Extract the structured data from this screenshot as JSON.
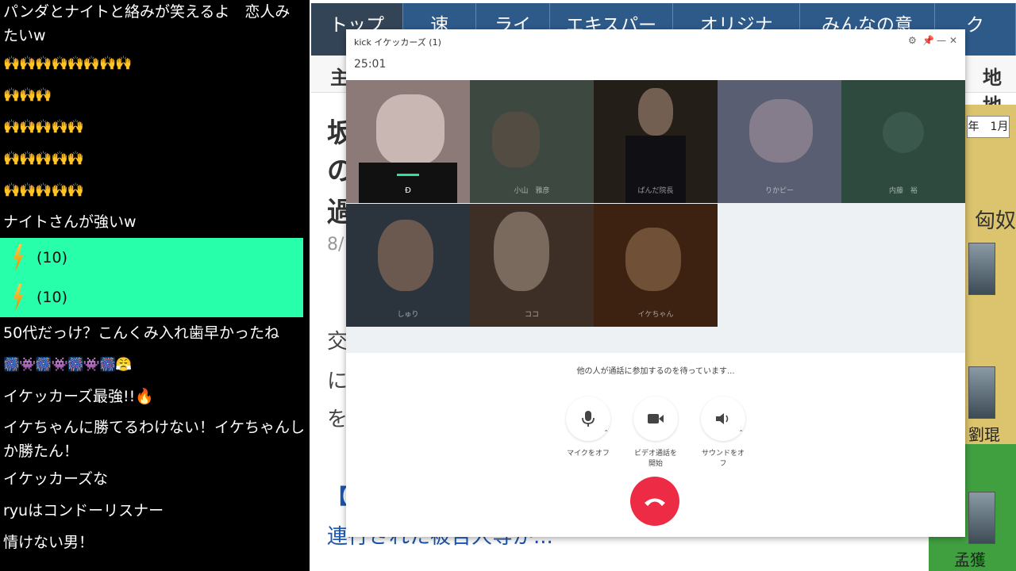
{
  "chat": {
    "messages": [
      {
        "type": "text",
        "text": "パンダとナイトと絡みが笑えるよ　恋人みたいw"
      },
      {
        "type": "emotes",
        "text": "🙌🙌🙌🙌🙌🙌🙌🙌"
      },
      {
        "type": "emotes",
        "text": "🙌🙌🙌"
      },
      {
        "type": "emotes",
        "text": "🙌🙌🙌🙌🙌"
      },
      {
        "type": "emotes",
        "text": "🙌🙌🙌🙌🙌"
      },
      {
        "type": "emotes",
        "text": "🙌🙌🙌🙌🙌"
      },
      {
        "type": "text",
        "text": "ナイトさんが強いw"
      },
      {
        "type": "tip",
        "text": "(10)"
      },
      {
        "type": "tip",
        "text": "(10)"
      },
      {
        "type": "text",
        "text": "50代だっけ？こんくみ入れ歯早かったね"
      },
      {
        "type": "emotes",
        "text": "🎆👾🎆👾🎆👾🎆😤"
      },
      {
        "type": "text",
        "text": "イケッカーズ最強!!🔥"
      },
      {
        "type": "text",
        "text": "イケちゃんに勝てるわけない！イケちゃんしか勝たん！"
      },
      {
        "type": "text",
        "text": "イケッカーズな"
      },
      {
        "type": "text",
        "text": "ryuはコンドーリスナー"
      },
      {
        "type": "text",
        "text": "情けない男！"
      }
    ]
  },
  "background_page": {
    "nav_tabs": [
      "トップ",
      "速",
      "ライ",
      "エキスパー",
      "オリジナ",
      "みんなの意",
      "ク"
    ],
    "sub_left": "主",
    "sub_right": "地地",
    "headline_lines": [
      "坂",
      "の",
      "過"
    ],
    "date_fragment": "8/",
    "body_fragments": [
      "交",
      "に",
      "を"
    ],
    "link_bracket": "【",
    "link_text": "連行された被告人等が...",
    "map_date": "年　1月",
    "map_label": "匈奴",
    "map_names": [
      "劉琨",
      "孟獲"
    ]
  },
  "call": {
    "title": "kick イケッカーズ  (1)",
    "timer": "25:01",
    "window_controls": [
      "⚙",
      "📌",
      "—",
      "✕"
    ],
    "participants": [
      {
        "name": "Đ",
        "color": "#5a5550"
      },
      {
        "name": "小山　雅彦",
        "color": "#6a7d6e"
      },
      {
        "name": "ぱんだ院長",
        "color": "#4a3f35"
      },
      {
        "name": "りかピー",
        "color": "#9aa3c4"
      },
      {
        "name": "内藤　裕",
        "color": "#4a6a5a"
      },
      {
        "name": "しゅり",
        "color": "#4a5a6a"
      },
      {
        "name": "ココ",
        "color": "#6a5240"
      },
      {
        "name": "イケちゃん",
        "color": "#6a3a1e"
      }
    ],
    "waiting_text": "他の人が通話に参加するのを待っています...",
    "controls": [
      {
        "icon": "microphone-icon",
        "label": "マイクをオフ"
      },
      {
        "icon": "video-camera-icon",
        "label": "ビデオ通話を開始"
      },
      {
        "icon": "speaker-icon",
        "label": "サウンドをオフ"
      }
    ],
    "hangup_color": "#ee2b45"
  }
}
